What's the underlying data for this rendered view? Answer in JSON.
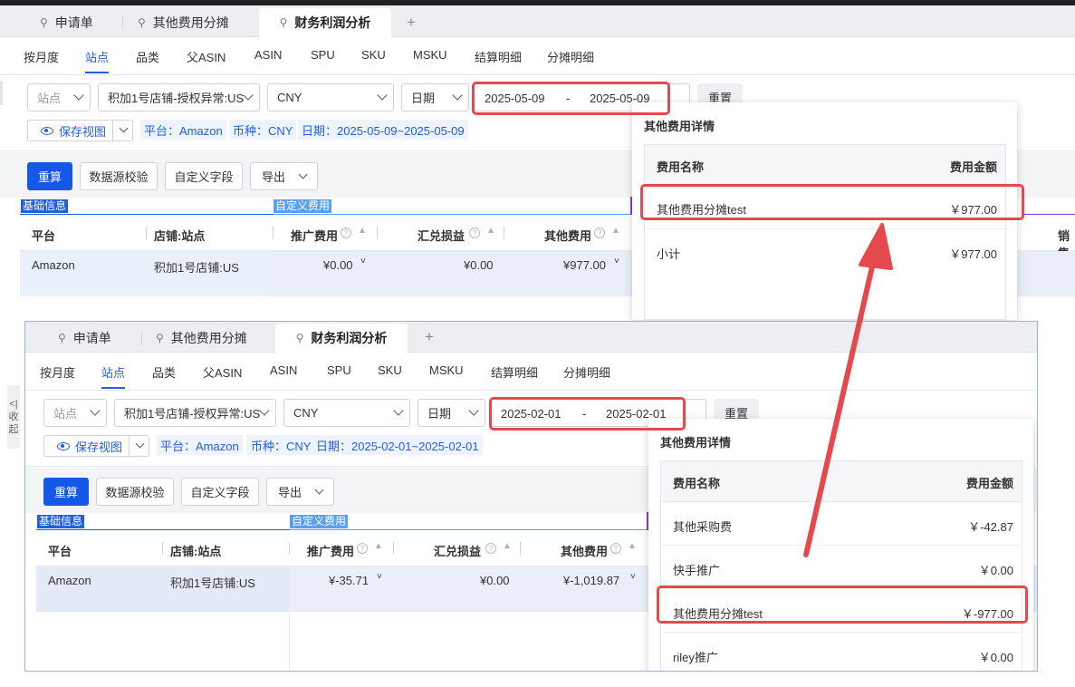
{
  "tabs": [
    "申请单",
    "其他费用分摊",
    "财务利润分析"
  ],
  "subnav": [
    "按月度",
    "站点",
    "品类",
    "父ASIN",
    "ASIN",
    "SPU",
    "SKU",
    "MSKU",
    "结算明细",
    "分摊明细"
  ],
  "filters": {
    "site_placeholder": "站点",
    "store": "积加1号店铺-授权异常:US",
    "currency": "CNY",
    "date_type": "日期",
    "reset": "重置",
    "save_view": "保存视图"
  },
  "toolbar": {
    "recalc": "重算",
    "validate": "数据源校验",
    "custom_fields": "自定义字段",
    "export": "导出"
  },
  "sections": {
    "basic": "基础信息",
    "custom": "自定义费用"
  },
  "columns": {
    "platform": "平台",
    "store_site": "店铺:站点",
    "promo": "推广费用",
    "fx": "汇兑损益",
    "other": "其他费用",
    "sales": "销售"
  },
  "popup_title": "其他费用详情",
  "popup_headers": {
    "name": "费用名称",
    "amount": "费用金额"
  },
  "top": {
    "date_start": "2025-05-09",
    "date_end": "2025-05-09",
    "tags": {
      "platform": "平台：Amazon",
      "currency": "币种：CNY",
      "date": "日期：2025-05-09~2025-05-09"
    },
    "row": {
      "platform": "Amazon",
      "store": "积加1号店铺:US",
      "promo": "¥0.00",
      "fx": "¥0.00",
      "other": "¥977.00"
    },
    "popup_rows": [
      {
        "name": "其他费用分摊test",
        "amount": "￥977.00"
      },
      {
        "name": "小计",
        "amount": "￥977.00"
      }
    ]
  },
  "bottom": {
    "date_start": "2025-02-01",
    "date_end": "2025-02-01",
    "tags": {
      "platform": "平台：Amazon",
      "currency": "币种：CNY",
      "date": "日期：2025-02-01~2025-02-01"
    },
    "row": {
      "platform": "Amazon",
      "store": "积加1号店铺:US",
      "promo": "¥-35.71",
      "fx": "¥0.00",
      "other": "¥-1,019.87"
    },
    "popup_rows": [
      {
        "name": "其他采购费",
        "amount": "￥-42.87"
      },
      {
        "name": "快手推广",
        "amount": "￥0.00"
      },
      {
        "name": "其他费用分摊test",
        "amount": "￥-977.00"
      },
      {
        "name": "riley推广",
        "amount": "￥0.00"
      }
    ]
  },
  "collapse_label": "<|收起",
  "colors": {
    "primary": "#1557e6",
    "annotation": "#e5484d"
  }
}
